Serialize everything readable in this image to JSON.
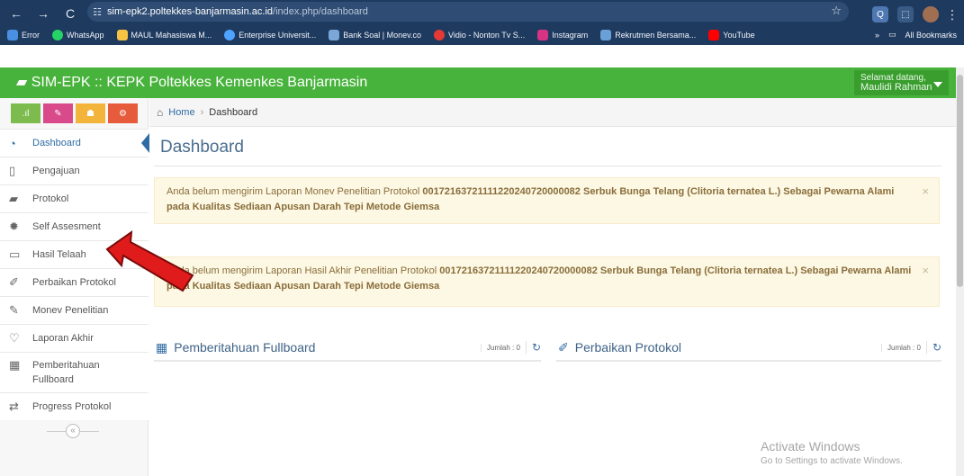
{
  "browser": {
    "url_host": "sim-epk2.poltekkes-banjarmasin.ac.id",
    "url_path": "/index.php/dashboard",
    "bookmarks": [
      {
        "label": "Error",
        "color": "#4a90e2"
      },
      {
        "label": "WhatsApp",
        "color": "#25d366"
      },
      {
        "label": "MAUL Mahasiswa M...",
        "color": "#f6c343"
      },
      {
        "label": "Enterprise Universit...",
        "color": "#4da3ff"
      },
      {
        "label": "Bank Soal | Monev.co",
        "color": "#7aa6d8"
      },
      {
        "label": "Vidio - Nonton Tv S...",
        "color": "#e53935"
      },
      {
        "label": "Instagram",
        "color": "#d63384"
      },
      {
        "label": "Rekrutmen Bersama...",
        "color": "#6aa0d8"
      },
      {
        "label": "YouTube",
        "color": "#ff0000"
      }
    ],
    "more_label": "»",
    "all_bookmarks": "All Bookmarks"
  },
  "header": {
    "brand": "SIM-EPK :: KEPK Poltekkes Kemenkes Banjarmasin",
    "welcome_line1": "Selamat datang,",
    "welcome_line2": "Maulidi Rahman"
  },
  "colors": {
    "header_green": "#48b33c",
    "accent_blue": "#2f6ca3",
    "shortcut_colors": [
      "#7dbb4f",
      "#d94a8a",
      "#f2b43b",
      "#e55b3c"
    ],
    "alert_bg": "#fcf8e3"
  },
  "sidebar": {
    "items": [
      {
        "label": "Dashboard",
        "icon": "dashboard-icon"
      },
      {
        "label": "Pengajuan",
        "icon": "file-icon"
      },
      {
        "label": "Protokol",
        "icon": "book-icon"
      },
      {
        "label": "Self Assesment",
        "icon": "gear-icon"
      },
      {
        "label": "Hasil Telaah",
        "icon": "monitor-icon"
      },
      {
        "label": "Perbaikan Protokol",
        "icon": "edit-icon"
      },
      {
        "label": "Monev Penelitian",
        "icon": "pencil-icon"
      },
      {
        "label": "Laporan Akhir",
        "icon": "lightbulb-icon"
      },
      {
        "label": "Pemberitahuan Fullboard",
        "icon": "grid-icon"
      },
      {
        "label": "Progress Protokol",
        "icon": "exchange-icon"
      }
    ]
  },
  "breadcrumb": {
    "home": "Home",
    "current": "Dashboard"
  },
  "main": {
    "title": "Dashboard",
    "alerts": [
      {
        "prefix": "Anda belum mengirim Laporan Monev Penelitian Protokol ",
        "bold": "00172163721111220240720000082 Serbuk Bunga Telang (Clitoria ternatea L.) Sebagai Pewarna Alami pada Kualitas Sediaan Apusan Darah Tepi Metode Giemsa"
      },
      {
        "prefix": "Anda belum mengirim Laporan Hasil Akhir Penelitian Protokol ",
        "bold": "00172163721111220240720000082 Serbuk Bunga Telang (Clitoria ternatea L.) Sebagai Pewarna Alami pada Kualitas Sediaan Apusan Darah Tepi Metode Giemsa"
      }
    ],
    "panels": [
      {
        "title": "Pemberitahuan Fullboard",
        "count": "Jumlah : 0"
      },
      {
        "title": "Perbaikan Protokol",
        "count": "Jumlah : 0"
      }
    ]
  },
  "watermark": {
    "title": "Activate Windows",
    "subtitle": "Go to Settings to activate Windows."
  }
}
